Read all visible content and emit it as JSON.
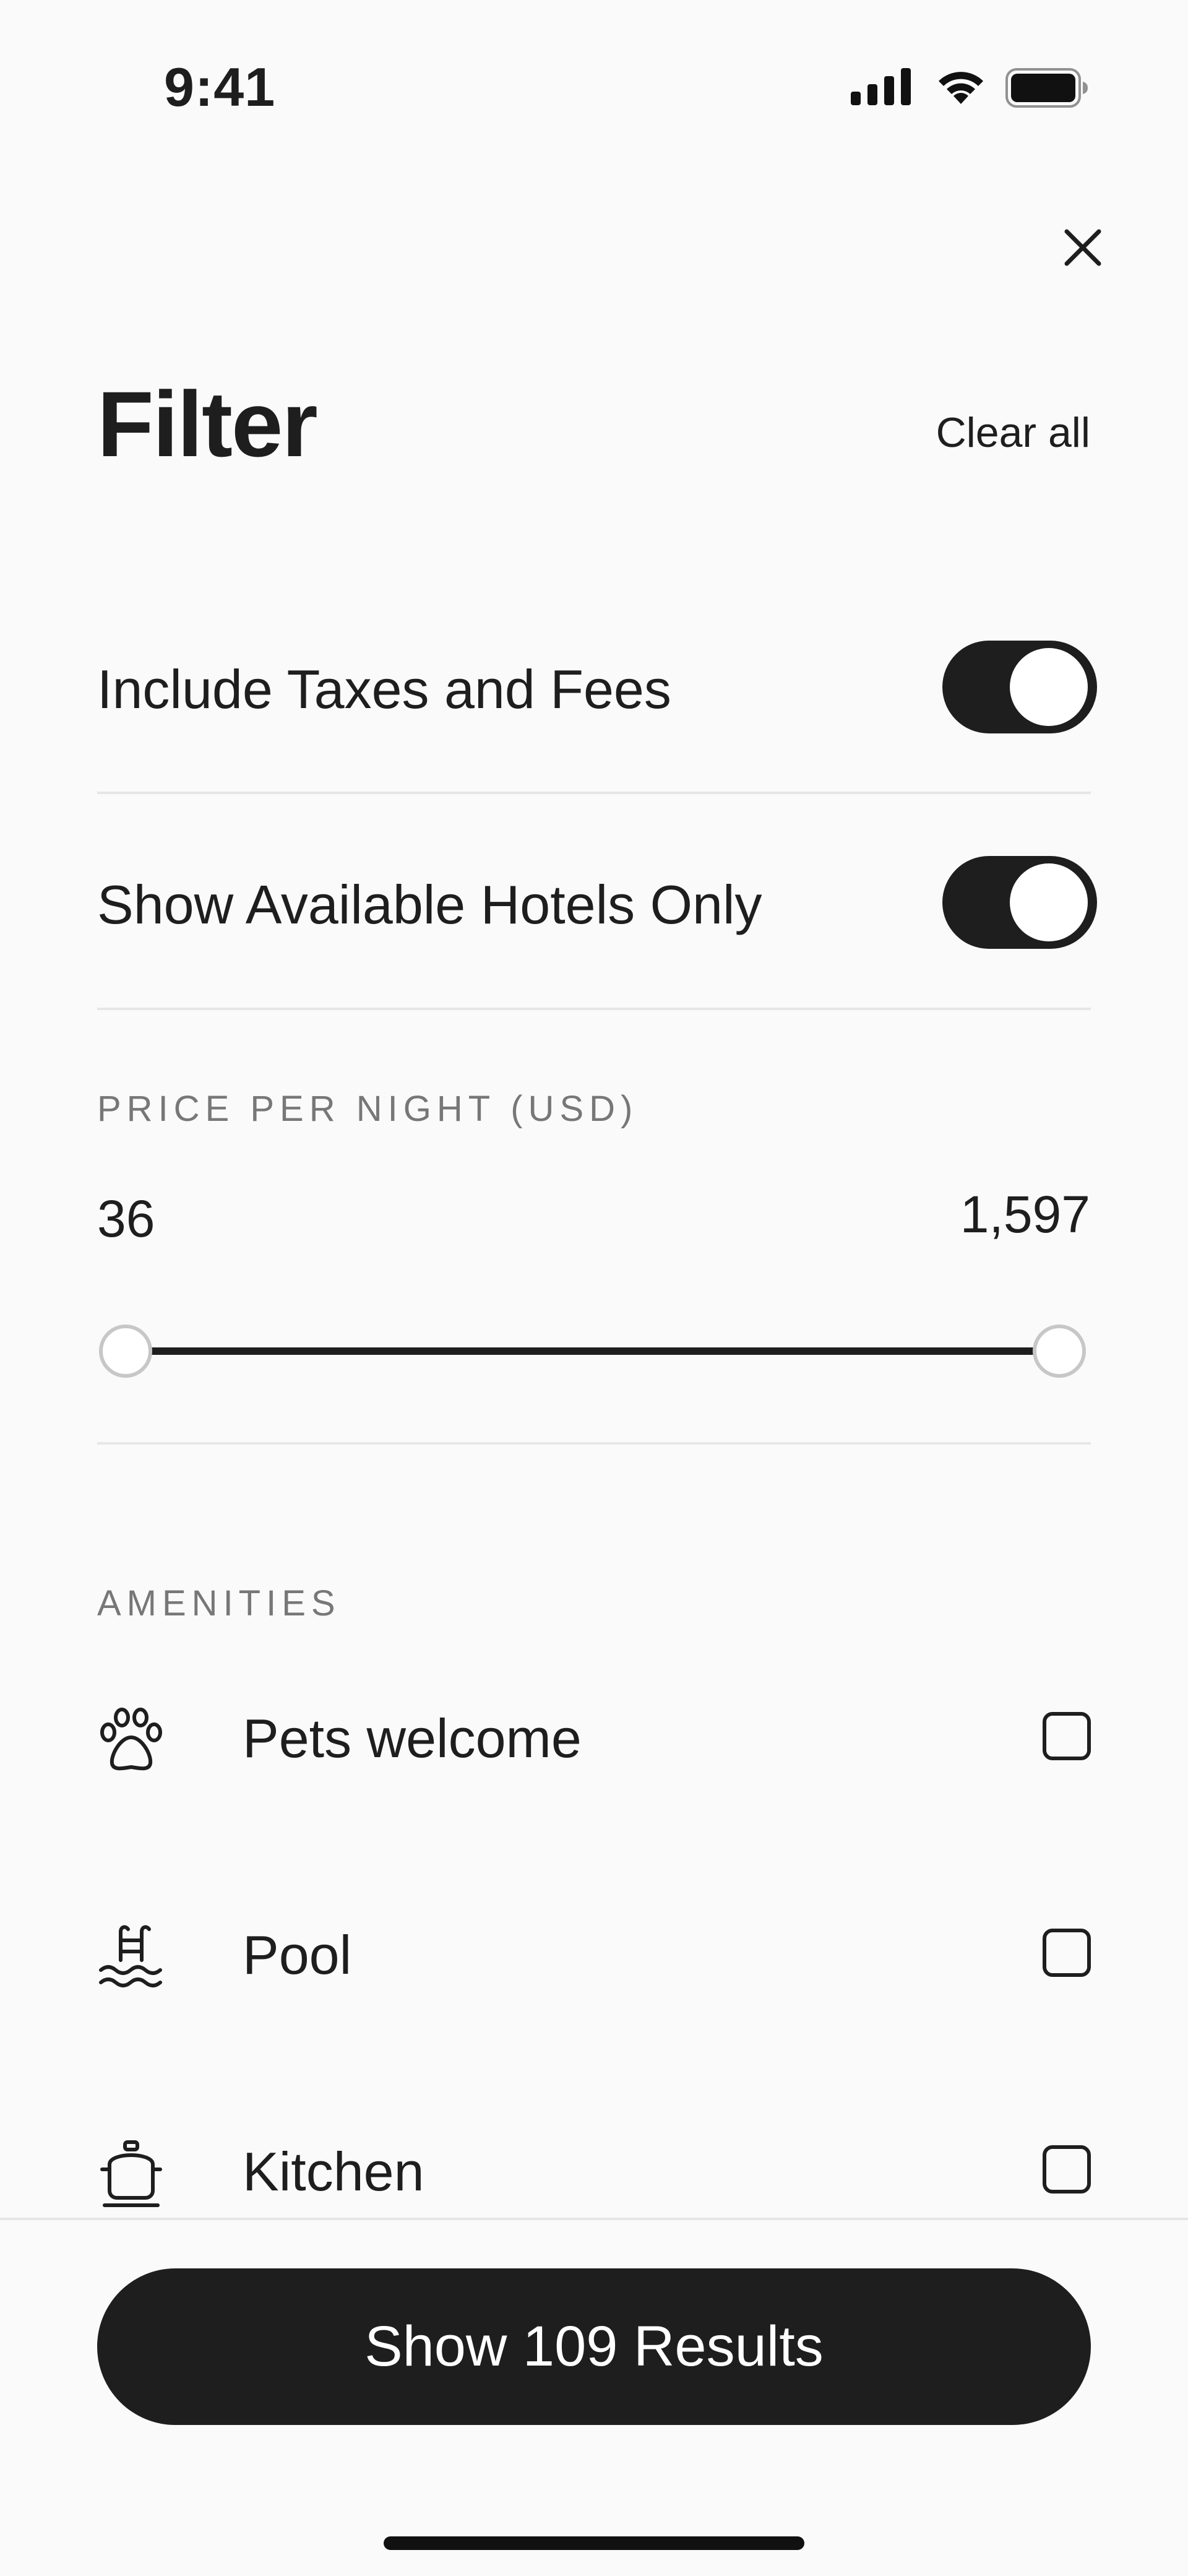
{
  "status_bar": {
    "time": "9:41",
    "icons": [
      "signal-icon",
      "wifi-icon",
      "battery-icon"
    ]
  },
  "header": {
    "close_icon": "close-icon",
    "title": "Filter",
    "clear_all_label": "Clear all"
  },
  "toggles": [
    {
      "label": "Include Taxes and Fees",
      "on": true
    },
    {
      "label": "Show Available Hotels Only",
      "on": true
    }
  ],
  "price": {
    "section_label": "PRICE PER NIGHT (USD)",
    "min_value": "36",
    "max_value": "1,597",
    "range_selected_fraction": [
      0,
      1
    ]
  },
  "amenities": {
    "section_label": "AMENITIES",
    "items": [
      {
        "label": "Pets welcome",
        "icon": "paw-icon",
        "checked": false
      },
      {
        "label": "Pool",
        "icon": "pool-icon",
        "checked": false
      },
      {
        "label": "Kitchen",
        "icon": "kitchen-icon",
        "checked": false
      }
    ]
  },
  "footer": {
    "cta_label": "Show 109 Results"
  },
  "colors": {
    "background": "#fafafa",
    "primary": "#1e1e1e",
    "muted_text": "#777777",
    "divider": "#e6e6e6"
  }
}
